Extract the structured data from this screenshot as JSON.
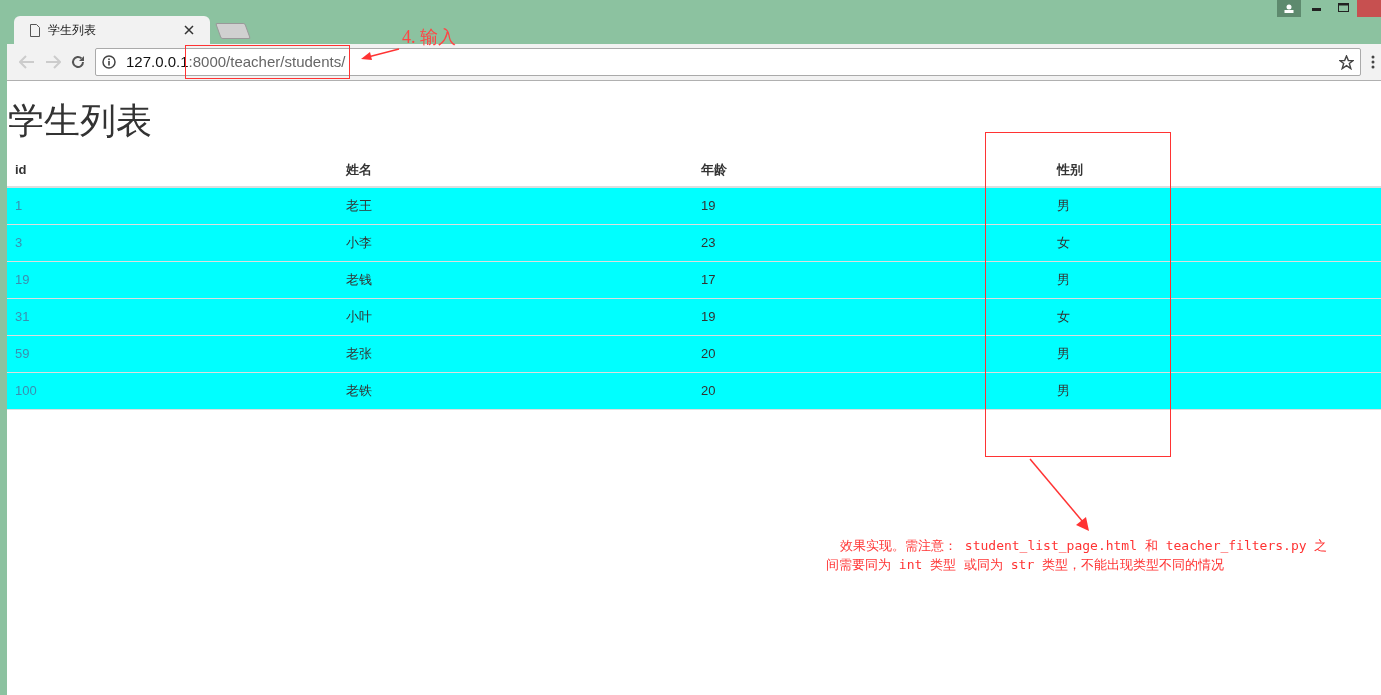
{
  "tab": {
    "title": "学生列表"
  },
  "address_bar": {
    "host": "127.0.0.1",
    "path": ":8000/teacher/students/"
  },
  "page": {
    "heading": "学生列表"
  },
  "table": {
    "columns": [
      "id",
      "姓名",
      "年龄",
      "性别"
    ],
    "rows": [
      {
        "id": "1",
        "name": "老王",
        "age": "19",
        "gender": "男"
      },
      {
        "id": "3",
        "name": "小李",
        "age": "23",
        "gender": "女"
      },
      {
        "id": "19",
        "name": "老钱",
        "age": "17",
        "gender": "男"
      },
      {
        "id": "31",
        "name": "小叶",
        "age": "19",
        "gender": "女"
      },
      {
        "id": "59",
        "name": "老张",
        "age": "20",
        "gender": "男"
      },
      {
        "id": "100",
        "name": "老铁",
        "age": "20",
        "gender": "男"
      }
    ]
  },
  "annotations": {
    "step_label": "4. 输入",
    "note_lines": [
      "效果实现。需注意： student_list_page.html 和 teacher_filters.py 之",
      "间需要同为 int 类型 或同为 str 类型，不能出现类型不同的情况"
    ]
  }
}
